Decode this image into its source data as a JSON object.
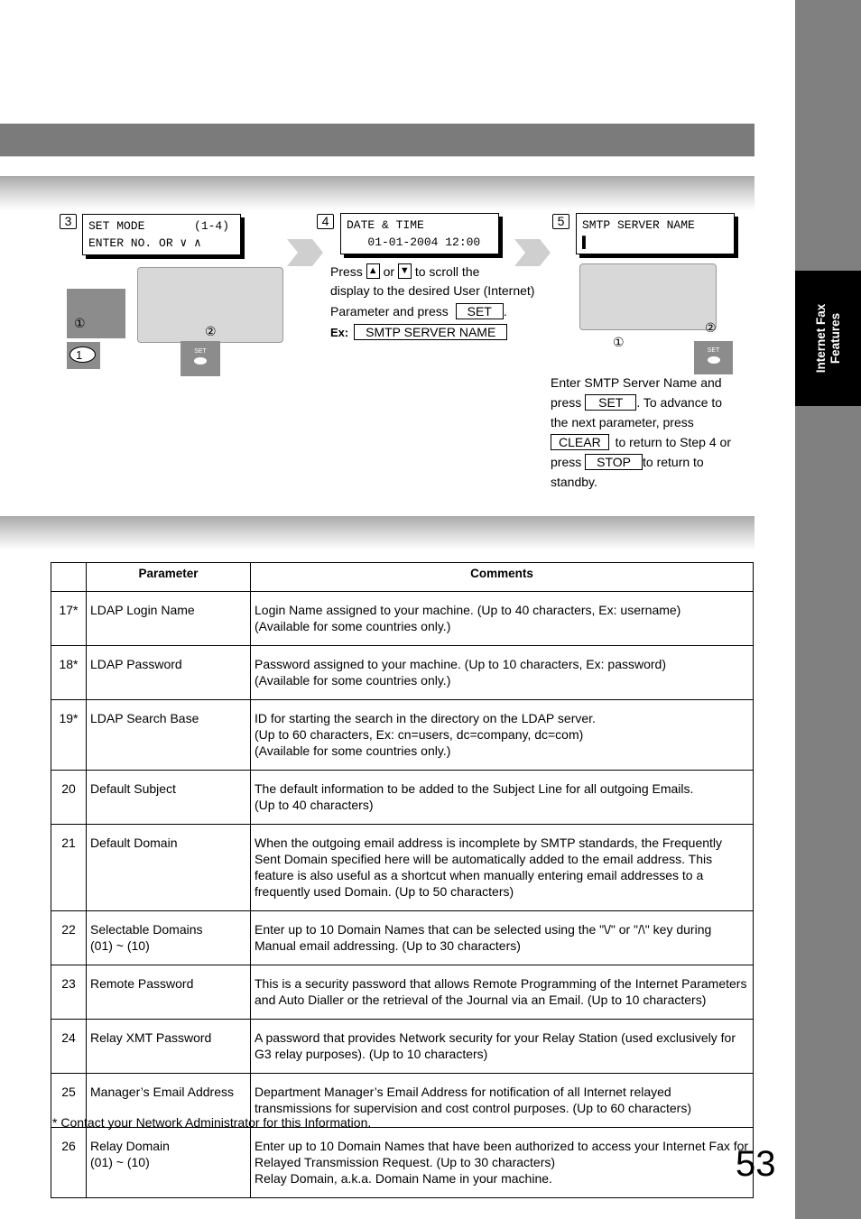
{
  "side_tab": {
    "line1": "Internet Fax",
    "line2": "Features"
  },
  "steps": [
    {
      "number": "3",
      "lcd_line1": "SET MODE       (1-4)",
      "lcd_line2": "ENTER NO. OR ∨ ∧",
      "keypad_key": "1",
      "set_key": "SET",
      "finger1": "①",
      "finger2": "②"
    },
    {
      "number": "4",
      "lcd_line1": "DATE & TIME",
      "lcd_line2": "   01-01-2004 12:00",
      "text_press": "Press",
      "text_or": "or",
      "text_scroll": "to scroll the",
      "text_line2": "display to the desired User (Internet)",
      "text_line3": "Parameter and press",
      "set_key": "SET",
      "period": ".",
      "ex_label": "Ex:",
      "ex_value": "SMTP SERVER NAME",
      "up_icon": "▲",
      "down_icon": "▼"
    },
    {
      "number": "5",
      "lcd_line1": "SMTP SERVER NAME",
      "lcd_line2": "▌",
      "set_key_label": "SET",
      "finger1": "①",
      "finger2": "②",
      "text_l1": "Enter SMTP Server Name and",
      "text_press": "press",
      "set_key": "SET",
      "text_advance": ". To advance to",
      "text_l3": "the next parameter, press",
      "clear_key": "CLEAR",
      "text_return4": "to return to Step 4 or",
      "text_press2": "press",
      "stop_key": "STOP",
      "text_return_to": "to return to",
      "text_standby": "standby."
    }
  ],
  "table": {
    "headers": [
      "",
      "Parameter",
      "Comments"
    ],
    "rows": [
      {
        "no": "17*",
        "param": [
          "LDAP Login Name"
        ],
        "comments": [
          "Login Name assigned to your machine. (Up to 40 characters, Ex: username)",
          "(Available for some countries only.)"
        ]
      },
      {
        "no": "18*",
        "param": [
          "LDAP Password"
        ],
        "comments": [
          "Password assigned to your machine. (Up to 10 characters, Ex: password)",
          "(Available for some countries only.)"
        ]
      },
      {
        "no": "19*",
        "param": [
          "LDAP Search Base"
        ],
        "comments": [
          "ID for starting the search in the directory on the LDAP server.",
          "(Up to 60 characters, Ex: cn=users, dc=company, dc=com)",
          "(Available for some countries only.)"
        ]
      },
      {
        "no": "20",
        "param": [
          "Default Subject"
        ],
        "comments": [
          "The default information to be added to the Subject Line for all outgoing Emails.",
          "(Up to 40 characters)"
        ]
      },
      {
        "no": "21",
        "param": [
          "Default Domain"
        ],
        "comments": [
          "When the outgoing email address is incomplete by SMTP standards, the Frequently Sent Domain specified here will be automatically added to the email address. This feature is also useful as a shortcut when manually entering email addresses to a frequently used Domain. (Up to 50 characters)"
        ]
      },
      {
        "no": "22",
        "param": [
          "Selectable Domains",
          "(01) ~ (10)"
        ],
        "comments": [
          "Enter up to 10 Domain Names that can be selected using the \"\\/\" or \"/\\\" key during Manual email addressing. (Up to 30 characters)"
        ]
      },
      {
        "no": "23",
        "param": [
          "Remote Password"
        ],
        "comments": [
          "This is a security password that allows Remote Programming of the Internet Parameters and Auto Dialler or the retrieval of the Journal via an Email. (Up to 10 characters)"
        ]
      },
      {
        "no": "24",
        "param": [
          "Relay XMT Password"
        ],
        "comments": [
          "A password that provides Network security for your Relay Station (used exclusively for G3 relay purposes). (Up to 10 characters)"
        ]
      },
      {
        "no": "25",
        "param": [
          "Manager’s Email Address"
        ],
        "comments": [
          "Department Manager’s Email Address for notification of all Internet relayed transmissions for supervision and cost control purposes. (Up to 60 characters)"
        ]
      },
      {
        "no": "26",
        "param": [
          "Relay Domain",
          "(01) ~ (10)"
        ],
        "comments": [
          "Enter up to 10 Domain Names that have been authorized to access your Internet Fax for Relayed Transmission Request. (Up to 30 characters)",
          "Relay Domain, a.k.a. Domain Name in your machine."
        ]
      }
    ]
  },
  "footnote": "* Contact your Network Administrator for this Information.",
  "page_number": "53"
}
